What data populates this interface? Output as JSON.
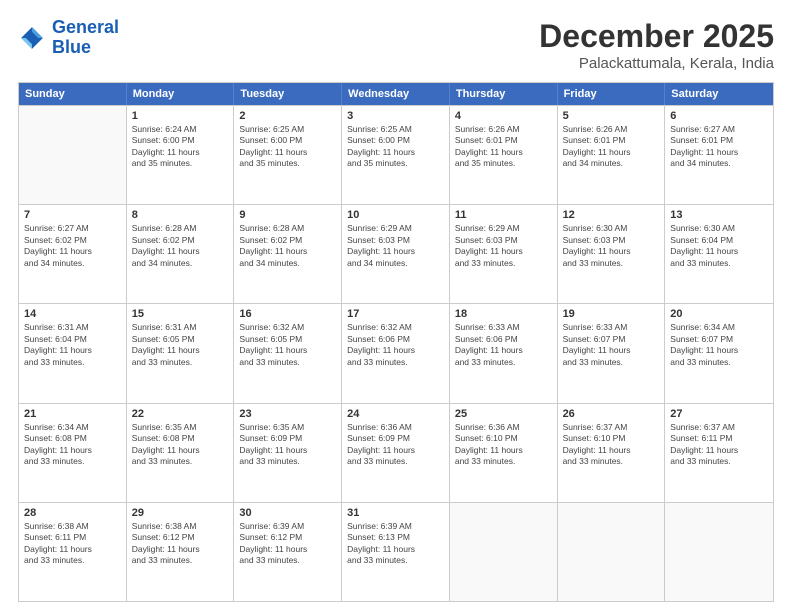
{
  "header": {
    "logo_general": "General",
    "logo_blue": "Blue",
    "title": "December 2025",
    "subtitle": "Palackattumala, Kerala, India"
  },
  "days_of_week": [
    "Sunday",
    "Monday",
    "Tuesday",
    "Wednesday",
    "Thursday",
    "Friday",
    "Saturday"
  ],
  "weeks": [
    [
      {
        "day": "",
        "info": ""
      },
      {
        "day": "1",
        "info": "Sunrise: 6:24 AM\nSunset: 6:00 PM\nDaylight: 11 hours\nand 35 minutes."
      },
      {
        "day": "2",
        "info": "Sunrise: 6:25 AM\nSunset: 6:00 PM\nDaylight: 11 hours\nand 35 minutes."
      },
      {
        "day": "3",
        "info": "Sunrise: 6:25 AM\nSunset: 6:00 PM\nDaylight: 11 hours\nand 35 minutes."
      },
      {
        "day": "4",
        "info": "Sunrise: 6:26 AM\nSunset: 6:01 PM\nDaylight: 11 hours\nand 35 minutes."
      },
      {
        "day": "5",
        "info": "Sunrise: 6:26 AM\nSunset: 6:01 PM\nDaylight: 11 hours\nand 34 minutes."
      },
      {
        "day": "6",
        "info": "Sunrise: 6:27 AM\nSunset: 6:01 PM\nDaylight: 11 hours\nand 34 minutes."
      }
    ],
    [
      {
        "day": "7",
        "info": "Sunrise: 6:27 AM\nSunset: 6:02 PM\nDaylight: 11 hours\nand 34 minutes."
      },
      {
        "day": "8",
        "info": "Sunrise: 6:28 AM\nSunset: 6:02 PM\nDaylight: 11 hours\nand 34 minutes."
      },
      {
        "day": "9",
        "info": "Sunrise: 6:28 AM\nSunset: 6:02 PM\nDaylight: 11 hours\nand 34 minutes."
      },
      {
        "day": "10",
        "info": "Sunrise: 6:29 AM\nSunset: 6:03 PM\nDaylight: 11 hours\nand 34 minutes."
      },
      {
        "day": "11",
        "info": "Sunrise: 6:29 AM\nSunset: 6:03 PM\nDaylight: 11 hours\nand 33 minutes."
      },
      {
        "day": "12",
        "info": "Sunrise: 6:30 AM\nSunset: 6:03 PM\nDaylight: 11 hours\nand 33 minutes."
      },
      {
        "day": "13",
        "info": "Sunrise: 6:30 AM\nSunset: 6:04 PM\nDaylight: 11 hours\nand 33 minutes."
      }
    ],
    [
      {
        "day": "14",
        "info": "Sunrise: 6:31 AM\nSunset: 6:04 PM\nDaylight: 11 hours\nand 33 minutes."
      },
      {
        "day": "15",
        "info": "Sunrise: 6:31 AM\nSunset: 6:05 PM\nDaylight: 11 hours\nand 33 minutes."
      },
      {
        "day": "16",
        "info": "Sunrise: 6:32 AM\nSunset: 6:05 PM\nDaylight: 11 hours\nand 33 minutes."
      },
      {
        "day": "17",
        "info": "Sunrise: 6:32 AM\nSunset: 6:06 PM\nDaylight: 11 hours\nand 33 minutes."
      },
      {
        "day": "18",
        "info": "Sunrise: 6:33 AM\nSunset: 6:06 PM\nDaylight: 11 hours\nand 33 minutes."
      },
      {
        "day": "19",
        "info": "Sunrise: 6:33 AM\nSunset: 6:07 PM\nDaylight: 11 hours\nand 33 minutes."
      },
      {
        "day": "20",
        "info": "Sunrise: 6:34 AM\nSunset: 6:07 PM\nDaylight: 11 hours\nand 33 minutes."
      }
    ],
    [
      {
        "day": "21",
        "info": "Sunrise: 6:34 AM\nSunset: 6:08 PM\nDaylight: 11 hours\nand 33 minutes."
      },
      {
        "day": "22",
        "info": "Sunrise: 6:35 AM\nSunset: 6:08 PM\nDaylight: 11 hours\nand 33 minutes."
      },
      {
        "day": "23",
        "info": "Sunrise: 6:35 AM\nSunset: 6:09 PM\nDaylight: 11 hours\nand 33 minutes."
      },
      {
        "day": "24",
        "info": "Sunrise: 6:36 AM\nSunset: 6:09 PM\nDaylight: 11 hours\nand 33 minutes."
      },
      {
        "day": "25",
        "info": "Sunrise: 6:36 AM\nSunset: 6:10 PM\nDaylight: 11 hours\nand 33 minutes."
      },
      {
        "day": "26",
        "info": "Sunrise: 6:37 AM\nSunset: 6:10 PM\nDaylight: 11 hours\nand 33 minutes."
      },
      {
        "day": "27",
        "info": "Sunrise: 6:37 AM\nSunset: 6:11 PM\nDaylight: 11 hours\nand 33 minutes."
      }
    ],
    [
      {
        "day": "28",
        "info": "Sunrise: 6:38 AM\nSunset: 6:11 PM\nDaylight: 11 hours\nand 33 minutes."
      },
      {
        "day": "29",
        "info": "Sunrise: 6:38 AM\nSunset: 6:12 PM\nDaylight: 11 hours\nand 33 minutes."
      },
      {
        "day": "30",
        "info": "Sunrise: 6:39 AM\nSunset: 6:12 PM\nDaylight: 11 hours\nand 33 minutes."
      },
      {
        "day": "31",
        "info": "Sunrise: 6:39 AM\nSunset: 6:13 PM\nDaylight: 11 hours\nand 33 minutes."
      },
      {
        "day": "",
        "info": ""
      },
      {
        "day": "",
        "info": ""
      },
      {
        "day": "",
        "info": ""
      }
    ]
  ]
}
